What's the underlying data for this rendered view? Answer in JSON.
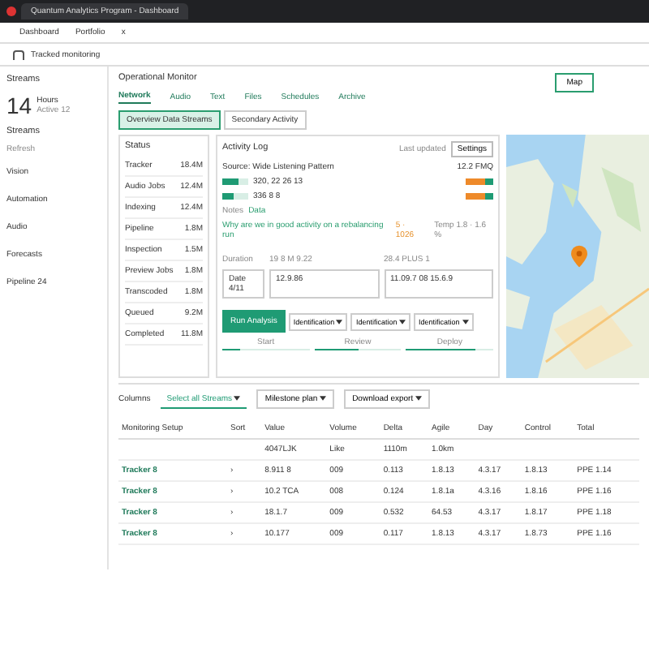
{
  "browser": {
    "tab_title": "Quantum Analytics Program - Dashboard",
    "nav_tabs": [
      "Dashboard",
      "Portfolio",
      "x"
    ],
    "address": "Tracked monitoring"
  },
  "sidebar": {
    "header": "Streams",
    "count": "14",
    "unit": "Hours",
    "sub": "Active 12",
    "filter": "Streams",
    "refresh": "Refresh",
    "items": [
      "Vision",
      "Automation",
      "Audio",
      "Forecasts",
      "Pipeline 24"
    ]
  },
  "main": {
    "title": "Operational Monitor",
    "map_button": "Map",
    "tabs": [
      {
        "label": "Network",
        "selected": true
      },
      {
        "label": "Audio",
        "selected": false
      },
      {
        "label": "Text",
        "selected": false
      },
      {
        "label": "Files",
        "selected": false
      },
      {
        "label": "Schedules",
        "selected": false
      },
      {
        "label": "Archive",
        "selected": false
      }
    ],
    "subtabs": [
      {
        "label": "Overview Data Streams",
        "selected": true
      },
      {
        "label": "Secondary Activity",
        "selected": false
      }
    ]
  },
  "status": {
    "title": "Status",
    "rows": [
      {
        "name": "Tracker",
        "value": "18.4M"
      },
      {
        "name": "Audio Jobs",
        "value": "12.4M"
      },
      {
        "name": "Indexing",
        "value": "12.4M"
      },
      {
        "name": "Pipeline",
        "value": "1.8M"
      },
      {
        "name": "Inspection",
        "value": "1.5M"
      },
      {
        "name": "Preview Jobs",
        "value": "1.8M"
      },
      {
        "name": "Transcoded",
        "value": "1.8M"
      },
      {
        "name": "Queued",
        "value": "9.2M"
      },
      {
        "name": "Completed",
        "value": "11.8M"
      }
    ]
  },
  "activity": {
    "title": "Activity Log",
    "updated": "Last updated",
    "settings": "Settings",
    "source": "Source: Wide Listening Pattern",
    "reading": "12.2 FMQ",
    "bars": [
      {
        "label": "320, 22 26 13",
        "level": 0.6
      },
      {
        "label": "336 8 8",
        "level": 0.45
      }
    ],
    "notes": "Notes",
    "note_value": "Data",
    "note": "Why are we in good activity on a rebalancing run",
    "note_tag": "5 · 1026",
    "temp": "Temp 1.8 · 1.6 %",
    "field_labels": [
      "Duration",
      "19 8 M 9.22",
      "28.4 PLUS 1"
    ],
    "fields": [
      "Date 4/11",
      "12.9.86",
      "11.09.7 08 15.6.9"
    ],
    "run": "Run Analysis",
    "dropdowns": [
      "Identification",
      "Identification",
      "Identification"
    ],
    "progress": [
      {
        "label": "Start",
        "level": 0.2
      },
      {
        "label": "Review",
        "level": 0.5
      },
      {
        "label": "Deploy",
        "level": 0.8
      }
    ]
  },
  "filters": {
    "label": "Columns",
    "dropdowns": [
      {
        "label": "Select all Streams",
        "selected": true
      },
      {
        "label": "Milestone plan",
        "selected": false
      },
      {
        "label": "Download export",
        "selected": false
      }
    ]
  },
  "table": {
    "columns": [
      "Monitoring Setup",
      "Sort",
      "Value",
      "Volume",
      "Delta",
      "Agile",
      "Day",
      "Control",
      "Total"
    ],
    "rows": [
      [
        "",
        "",
        "4047LJK",
        "Like",
        "1110m",
        "1.0km",
        "",
        "",
        ""
      ],
      [
        "Tracker 8",
        "›",
        "8.911 8",
        "009",
        "0.113",
        "1.8.13",
        "4.3.17",
        "1.8.13",
        "PPE 1.14"
      ],
      [
        "Tracker 8",
        "›",
        "10.2 TCA",
        "008",
        "0.124",
        "1.8.1a",
        "4.3.16",
        "1.8.16",
        "PPE 1.16"
      ],
      [
        "Tracker 8",
        "›",
        "18.1.7",
        "009",
        "0.532",
        "64.53",
        "4.3.17",
        "1.8.17",
        "PPE 1.18"
      ],
      [
        "Tracker 8",
        "›",
        "10.177",
        "009",
        "0.117",
        "1.8.13",
        "4.3.17",
        "1.8.73",
        "PPE 1.16"
      ]
    ]
  }
}
